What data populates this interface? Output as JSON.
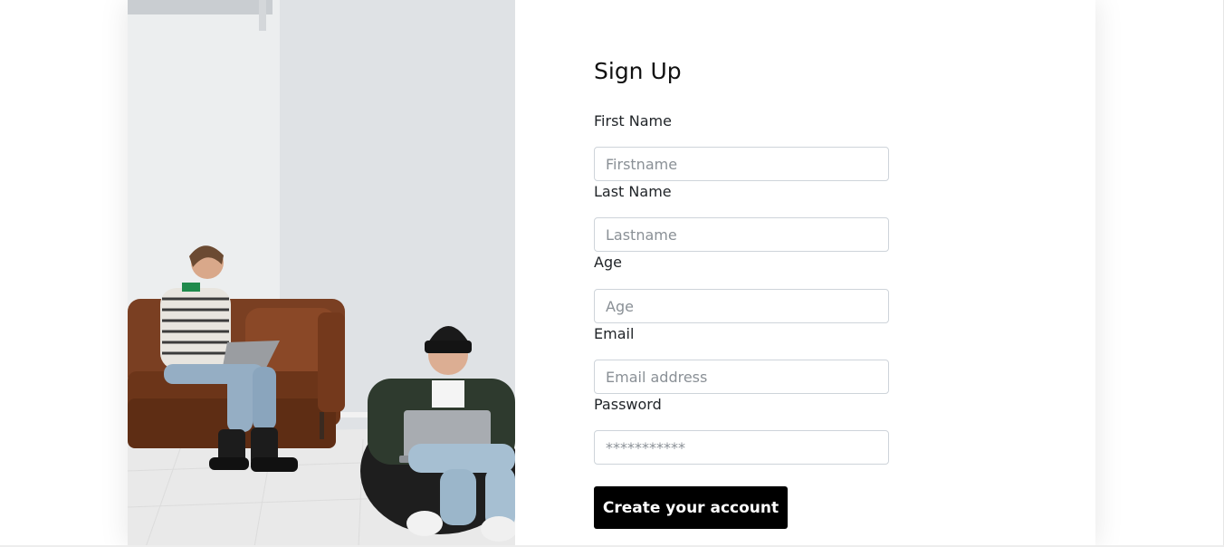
{
  "form": {
    "title": "Sign Up",
    "fields": [
      {
        "label": "First Name",
        "placeholder": "Firstname",
        "value": ""
      },
      {
        "label": "Last Name",
        "placeholder": "Lastname",
        "value": ""
      },
      {
        "label": "Age",
        "placeholder": "Age",
        "value": ""
      },
      {
        "label": "Email",
        "placeholder": "Email address",
        "value": ""
      },
      {
        "label": "Password",
        "placeholder": "***********",
        "value": ""
      }
    ],
    "submit_label": "Create your account"
  },
  "colors": {
    "button_bg": "#000000",
    "button_text": "#ffffff",
    "input_border": "#ced4da",
    "placeholder": "#8a9096"
  }
}
